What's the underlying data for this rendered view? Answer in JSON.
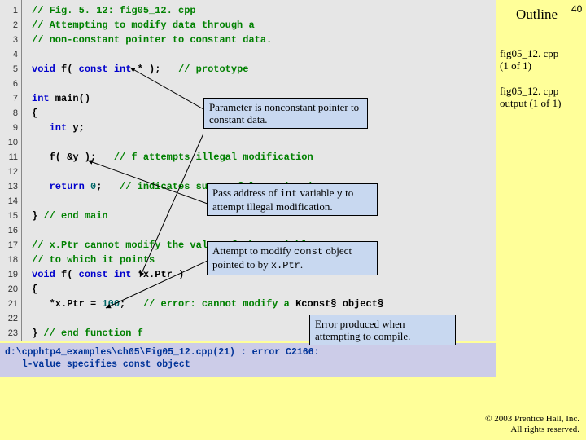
{
  "pageNumber": "40",
  "outlineTitle": "Outline",
  "sideLabels": {
    "file": "fig05_12. cpp\n(1 of 1)",
    "output": "fig05_12. cpp\noutput (1 of 1)"
  },
  "codeLines": [
    "// Fig. 5. 12: fig05_12. cpp",
    "// Attempting to modify data through a",
    "// non-constant pointer to constant data.",
    "",
    "void f( const int * );   // prototype",
    "",
    "int main()",
    "{",
    "   int y;",
    "",
    "   f( &y );   // f attempts illegal modification",
    "",
    "   return 0;   // indicates successful termination",
    "",
    "} // end main",
    "",
    "// x.Ptr cannot modify the value of the variable",
    "// to which it points",
    "void f( const int *x.Ptr )",
    "{",
    "   *x.Ptr = 100;   // error: cannot modify a const object",
    "",
    "} // end function f"
  ],
  "callouts": {
    "c1": "Parameter is nonconstant pointer to constant data.",
    "c2_a": "Pass address of ",
    "c2_b": "int",
    "c2_c": " variable ",
    "c2_d": "y",
    "c2_e": " to attempt illegal modification.",
    "c3_a": "Attempt to modify ",
    "c3_b": "const",
    "c3_c": " object pointed to by ",
    "c3_d": "x.Ptr",
    "c3_e": ".",
    "c4": "Error produced when attempting to compile."
  },
  "compileError": "d:\\cpphtp4_examples\\ch05\\Fig05_12.cpp(21) : error C2166:\n   l-value specifies const object",
  "footer": {
    "line1": "© 2003 Prentice Hall, Inc.",
    "line2": "All rights reserved."
  }
}
